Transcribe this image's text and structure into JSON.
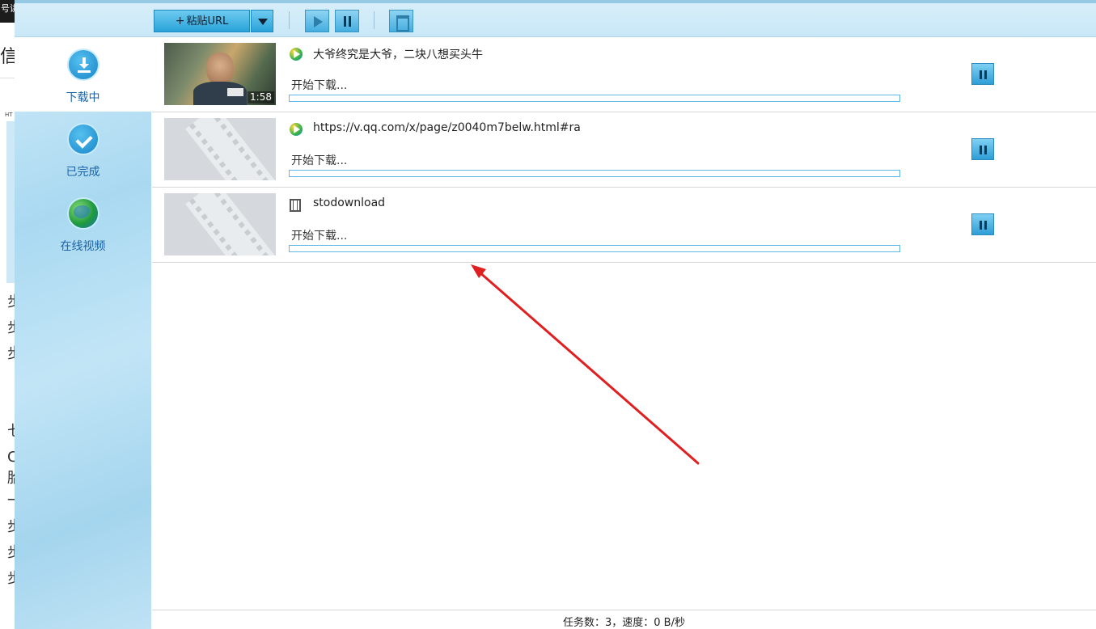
{
  "background_window": {
    "topbar_text": "号讲",
    "heading_char": "信",
    "small_text": "HT",
    "side_chars": [
      "步",
      "步",
      "步",
      "七",
      "C",
      "胎",
      "一",
      "步",
      "步",
      "步"
    ]
  },
  "toolbar": {
    "paste_url_label": "粘贴URL",
    "icons": {
      "dropdown": "chevron-down-icon",
      "start": "play-icon",
      "pause": "pause-icon",
      "delete": "trash-icon"
    }
  },
  "sidebar": {
    "items": [
      {
        "label": "下载中",
        "icon": "download-icon",
        "active": true
      },
      {
        "label": "已完成",
        "icon": "check-circle-icon",
        "active": false
      },
      {
        "label": "在线视频",
        "icon": "globe-icon",
        "active": false
      }
    ]
  },
  "downloads": [
    {
      "title": "大爷终究是大爷，二块八想买头牛",
      "status": "开始下载...",
      "duration": "1:58",
      "source_icon": "tencent-video-icon",
      "thumbnail": "photo",
      "progress": 0
    },
    {
      "title": "https://v.qq.com/x/page/z0040m7belw.html#ra",
      "status": "开始下载...",
      "duration": "",
      "source_icon": "tencent-video-icon",
      "thumbnail": "placeholder-film",
      "progress": 0
    },
    {
      "title": "stodownload",
      "status": "开始下载...",
      "duration": "",
      "source_icon": "film-icon",
      "thumbnail": "placeholder-film",
      "progress": 0
    }
  ],
  "statusbar": {
    "text": "任务数：3，速度：0 B/秒"
  },
  "colors": {
    "accent_blue": "#2aa3d9",
    "sidebar_label": "#1a63a8",
    "annotation_arrow": "#e02020"
  }
}
